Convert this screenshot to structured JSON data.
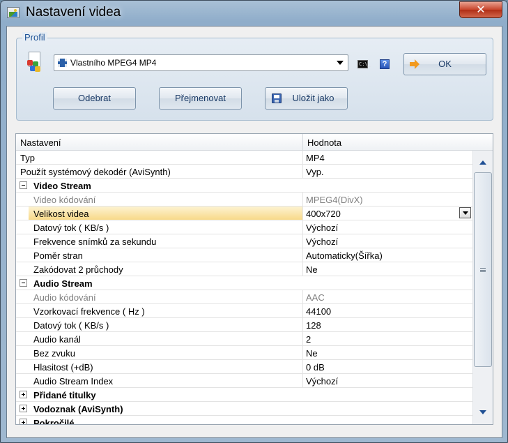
{
  "window": {
    "title": "Nastavení videa",
    "close_label": "✕"
  },
  "profile": {
    "group_label": "Profil",
    "selected": "Vlastního MPEG4 MP4",
    "cmd_label": "C:\\_",
    "help_label": "?",
    "ok_label": "OK",
    "remove_label": "Odebrat",
    "rename_label": "Přejmenovat",
    "save_as_label": "Uložit jako"
  },
  "grid": {
    "col_name": "Nastavení",
    "col_value": "Hodnota",
    "rows": [
      {
        "name": "Typ",
        "value": "MP4"
      },
      {
        "name": "Použít systémový dekodér (AviSynth)",
        "value": "Vyp."
      },
      {
        "name": "Video Stream",
        "category": "expanded"
      },
      {
        "name": "Video kódování",
        "value": "MPEG4(DivX)",
        "disabled": true
      },
      {
        "name": "Velikost videa",
        "value": "400x720",
        "selected": true
      },
      {
        "name": "Datový tok ( KB/s )",
        "value": "Výchozí"
      },
      {
        "name": "Frekvence snímků za sekundu",
        "value": "Výchozí"
      },
      {
        "name": "Poměr stran",
        "value": "Automaticky(Šířka)"
      },
      {
        "name": "Zakódovat 2 průchody",
        "value": "Ne"
      },
      {
        "name": "Audio Stream",
        "category": "expanded"
      },
      {
        "name": "Audio kódování",
        "value": "AAC",
        "disabled": true
      },
      {
        "name": "Vzorkovací frekvence ( Hz )",
        "value": "44100"
      },
      {
        "name": "Datový tok ( KB/s )",
        "value": "128"
      },
      {
        "name": "Audio kanál",
        "value": "2"
      },
      {
        "name": "Bez zvuku",
        "value": "Ne"
      },
      {
        "name": "Hlasitost (+dB)",
        "value": "0 dB"
      },
      {
        "name": "Audio Stream Index",
        "value": "Výchozí"
      },
      {
        "name": "Přidané titulky",
        "category": "collapsed"
      },
      {
        "name": "Vodoznak (AviSynth)",
        "category": "collapsed"
      },
      {
        "name": "Pokročilé",
        "category": "collapsed"
      }
    ]
  },
  "colors": {
    "accent": "#1d5296",
    "selection": "#f8d989",
    "close": "#c7442b"
  }
}
